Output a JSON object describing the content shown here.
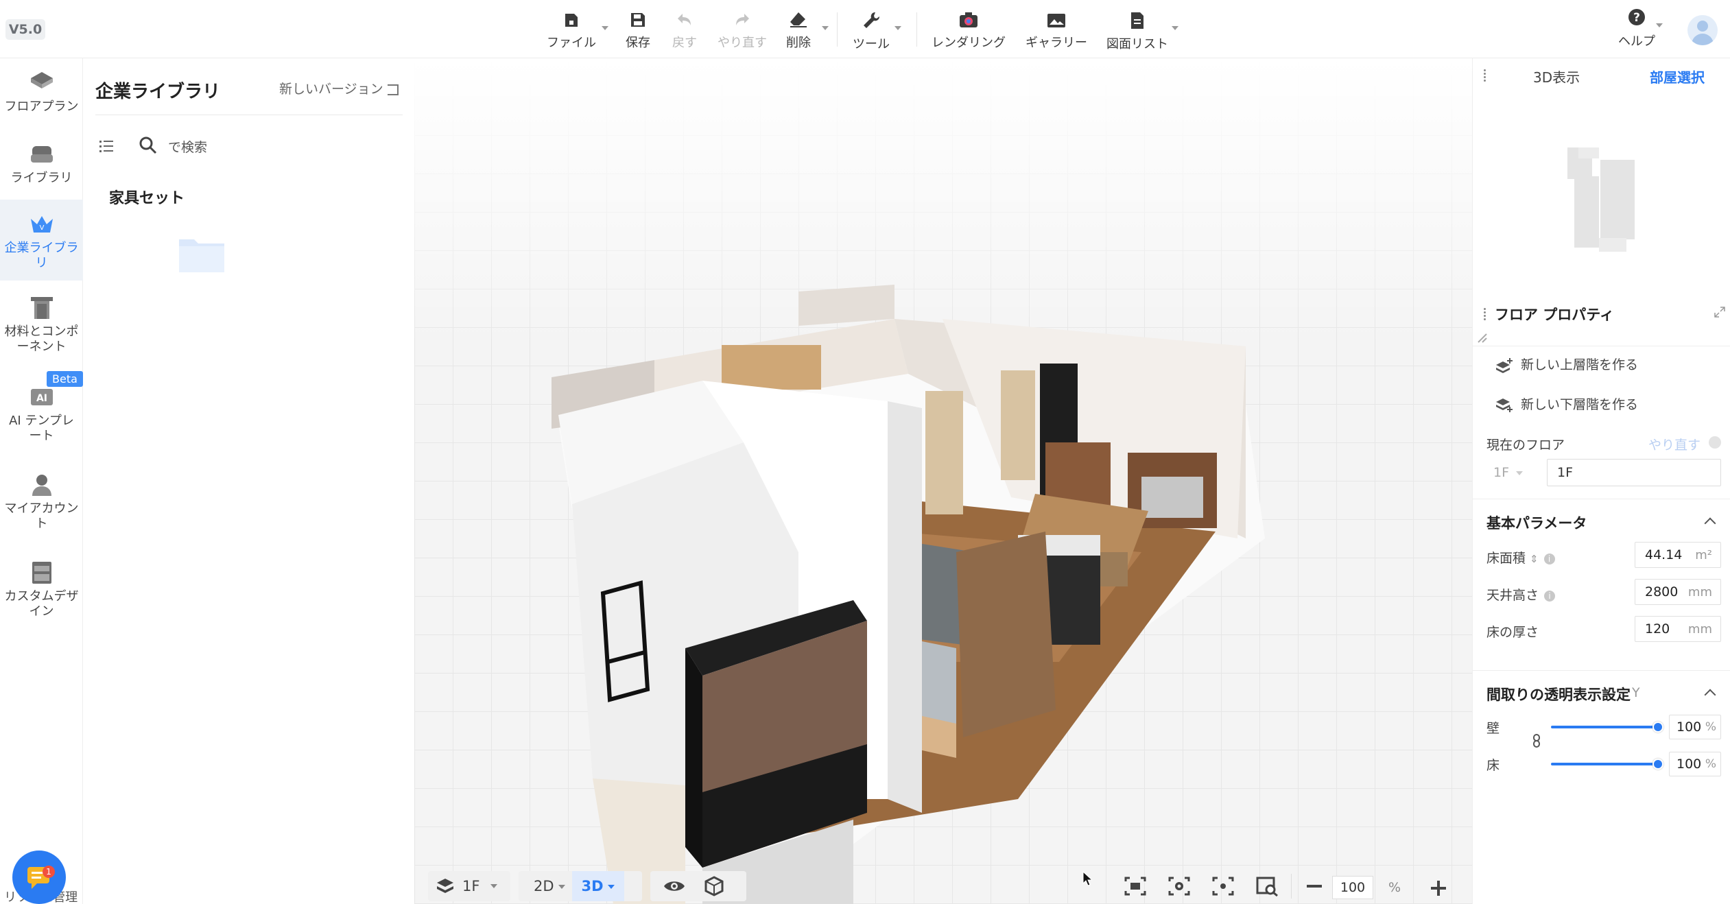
{
  "app": {
    "version": "V5.0"
  },
  "toolbar": {
    "items": [
      {
        "label": "ファイル",
        "icon": "file-home-icon",
        "enabled": true
      },
      {
        "label": "保存",
        "icon": "save-icon",
        "enabled": true
      },
      {
        "label": "戻す",
        "icon": "undo-icon",
        "enabled": false
      },
      {
        "label": "やり直す",
        "icon": "redo-icon",
        "enabled": false
      },
      {
        "label": "削除",
        "icon": "eraser-icon",
        "enabled": true
      },
      {
        "label": "ツール",
        "icon": "wrench-icon",
        "enabled": true
      },
      {
        "label": "レンダリング",
        "icon": "camera-icon",
        "enabled": true
      },
      {
        "label": "ギャラリー",
        "icon": "gallery-icon",
        "enabled": true
      },
      {
        "label": "図面リスト",
        "icon": "drawing-list-icon",
        "enabled": true
      }
    ],
    "help_label": "ヘルプ"
  },
  "leftnav": {
    "items": [
      {
        "label": "フロアプラン",
        "icon": "floorplan-icon"
      },
      {
        "label": "ライブラリ",
        "icon": "sofa-icon"
      },
      {
        "label": "企業ライブラリ",
        "icon": "crown-icon",
        "active": true
      },
      {
        "label": "材料とコンポーネント",
        "icon": "door-icon"
      },
      {
        "label": "AI テンプレート",
        "icon": "ai-template-icon"
      },
      {
        "label": "マイアカウント",
        "icon": "user-icon"
      },
      {
        "label": "カスタムデザイン",
        "icon": "cabinet-icon"
      }
    ],
    "beta_badge": "Beta",
    "bottom_label": "リソース管理",
    "chat_badge": "1"
  },
  "library": {
    "title": "企業ライブラリ",
    "new_version": "新しいバージョン",
    "search_placeholder": "で検索",
    "section": "家具セット"
  },
  "viewport": {
    "floor": "1F",
    "mode_2d": "2D",
    "mode_3d": "3D",
    "active_mode": "3D",
    "zoom": "100",
    "zoom_unit": "%"
  },
  "rightpanel": {
    "view_3d": "3D表示",
    "room_select": "部屋選択",
    "floor_props_title": "フロア プロパティ",
    "add_upper": "新しい上層階を作る",
    "add_lower": "新しい下層階を作る",
    "current_floor_label": "現在のフロア",
    "redo_label": "やり直す",
    "floor_select": "1F",
    "floor_name": "1F",
    "basic_params_title": "基本パラメータ",
    "params": [
      {
        "label": "床面積",
        "value": "44.14",
        "unit": "m²"
      },
      {
        "label": "天井高さ",
        "value": "2800",
        "unit": "mm"
      },
      {
        "label": "床の厚さ",
        "value": "120",
        "unit": "mm"
      }
    ],
    "transparency_title": "間取りの透明表示設定",
    "transparency_hint": "Y",
    "transparency": [
      {
        "label": "壁",
        "value": "100",
        "unit": "%",
        "level": 1.0
      },
      {
        "label": "床",
        "value": "100",
        "unit": "%",
        "level": 1.0
      }
    ]
  },
  "colors": {
    "accent": "#2a7bf2",
    "beta": "#3f8ef7"
  }
}
